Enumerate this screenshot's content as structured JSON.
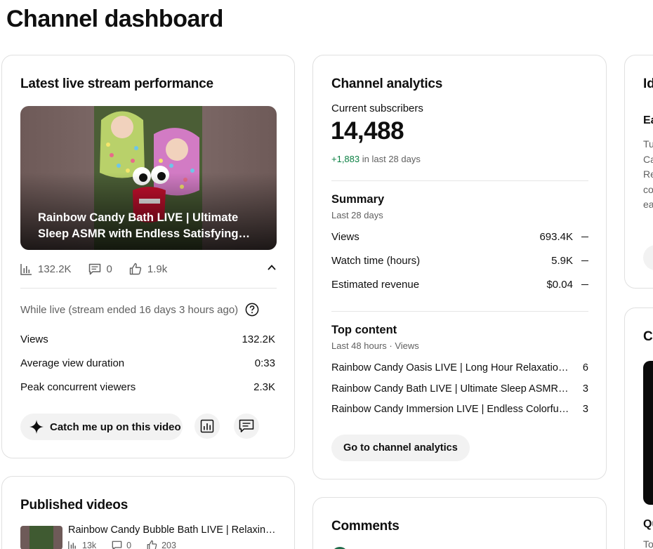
{
  "page": {
    "title": "Channel dashboard"
  },
  "live_card": {
    "title": "Latest live stream performance",
    "video_title": "Rainbow Candy Bath LIVE | Ultimate Sleep ASMR with Endless Satisfying…",
    "stats": {
      "views": "132.2K",
      "comments": "0",
      "likes": "1.9k"
    },
    "status": "While live (stream ended 16 days 3 hours ago)",
    "metrics": [
      {
        "label": "Views",
        "value": "132.2K"
      },
      {
        "label": "Average view duration",
        "value": "0:33"
      },
      {
        "label": "Peak concurrent viewers",
        "value": "2.3K"
      }
    ],
    "catch_up_label": "Catch me up on this video"
  },
  "analytics_card": {
    "title": "Channel analytics",
    "subscribers_label": "Current subscribers",
    "subscribers": "14,488",
    "change_value": "+1,883",
    "change_period": "in last 28 days",
    "summary_title": "Summary",
    "summary_period": "Last 28 days",
    "summary_rows": [
      {
        "label": "Views",
        "value": "693.4K"
      },
      {
        "label": "Watch time (hours)",
        "value": "5.9K"
      },
      {
        "label": "Estimated revenue",
        "value": "$0.04"
      }
    ],
    "top_title": "Top content",
    "top_period": "Last 48 hours · Views",
    "top_rows": [
      {
        "title": "Rainbow Candy Oasis LIVE | Long Hour Relaxation with Endless",
        "value": "6"
      },
      {
        "title": "Rainbow Candy Bath LIVE | Ultimate Sleep ASMR with Endless",
        "value": "3"
      },
      {
        "title": "Rainbow Candy Immersion LIVE | Endless Colorful Candy",
        "value": "3"
      }
    ],
    "button_label": "Go to channel analytics"
  },
  "ideas_card": {
    "title": "Id",
    "subtitle": "Ea",
    "lines": [
      "Tu",
      "Ca",
      "Re",
      "co",
      "ea"
    ]
  },
  "creator_card": {
    "title": "Cr",
    "caption": "Qu",
    "sub": "To"
  },
  "published_card": {
    "title": "Published videos",
    "video_title": "Rainbow Candy Bubble Bath LIVE | Relaxing…",
    "views": "13k",
    "comments": "0",
    "likes": "203"
  },
  "comments_card": {
    "title": "Comments"
  },
  "colors": {
    "positive": "#0b8043",
    "secondary_text": "#606060",
    "chip_bg": "#f2f2f2"
  }
}
